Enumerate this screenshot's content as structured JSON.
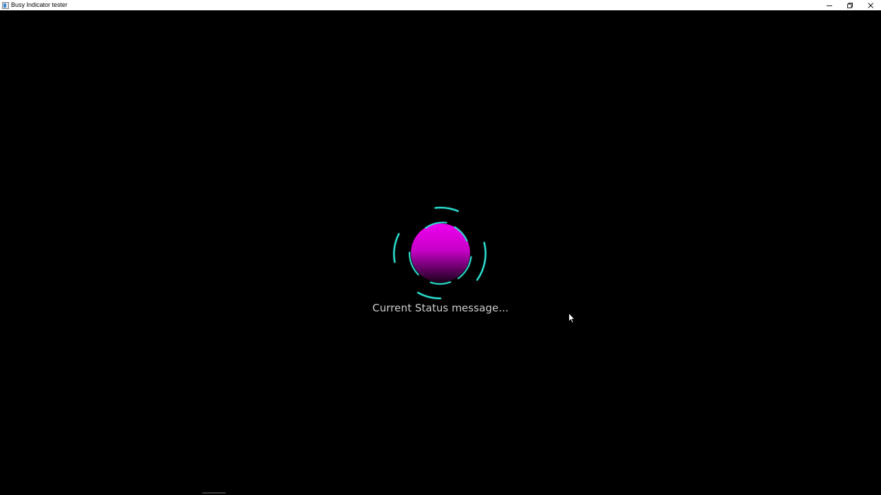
{
  "window": {
    "title": "Busy Indicator tester"
  },
  "caption_buttons": {
    "minimize_icon": "minimize-icon",
    "restore_icon": "restore-icon",
    "close_icon": "close-icon"
  },
  "busy_indicator": {
    "ball_color_top": "#e600e6",
    "ball_color_bottom": "#2a002a",
    "ring_color": "#2ee6d6"
  },
  "status": {
    "message": "Current Status message..."
  },
  "colors": {
    "background": "#000000",
    "titlebar": "#ffffff",
    "status_text": "#cfcfcf"
  }
}
